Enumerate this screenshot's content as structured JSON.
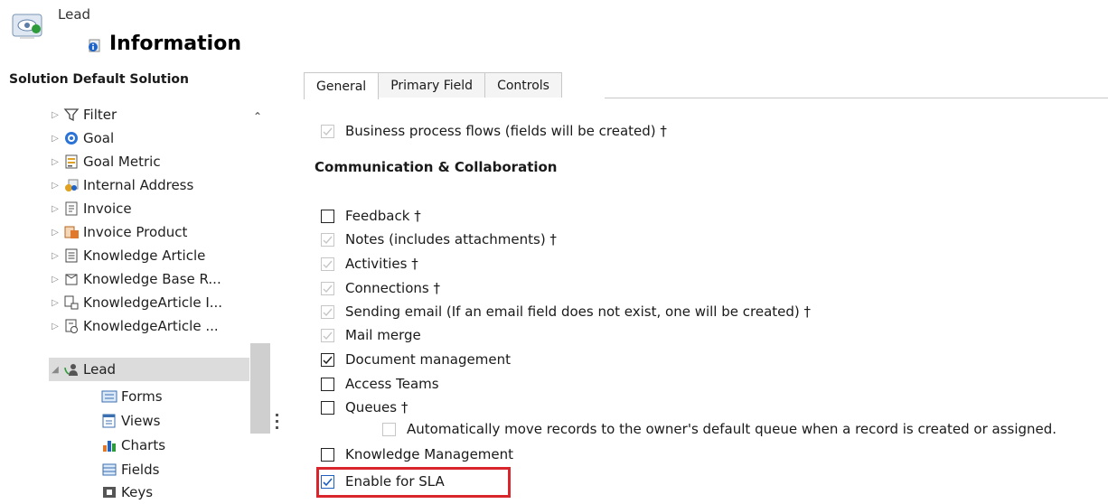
{
  "header": {
    "entity_name": "Lead",
    "page_title": "Information"
  },
  "solution": {
    "title": "Solution Default Solution"
  },
  "tree": {
    "items": [
      {
        "label": "Filter",
        "icon": "filter-icon"
      },
      {
        "label": "Goal",
        "icon": "goal-icon"
      },
      {
        "label": "Goal Metric",
        "icon": "goal-metric-icon"
      },
      {
        "label": "Internal Address",
        "icon": "address-icon"
      },
      {
        "label": "Invoice",
        "icon": "invoice-icon"
      },
      {
        "label": "Invoice Product",
        "icon": "invoice-product-icon"
      },
      {
        "label": "Knowledge Article",
        "icon": "article-icon"
      },
      {
        "label": "Knowledge Base R...",
        "icon": "kb-record-icon"
      },
      {
        "label": "KnowledgeArticle I...",
        "icon": "article-incident-icon"
      },
      {
        "label": "KnowledgeArticle ...",
        "icon": "article-views-icon"
      },
      {
        "label": "Lead",
        "icon": "lead-icon"
      }
    ],
    "children": [
      {
        "label": "Forms",
        "icon": "forms-icon"
      },
      {
        "label": "Views",
        "icon": "views-icon"
      },
      {
        "label": "Charts",
        "icon": "charts-icon"
      },
      {
        "label": "Fields",
        "icon": "fields-icon"
      },
      {
        "label": "Keys",
        "icon": "keys-icon"
      }
    ]
  },
  "tabs": [
    {
      "label": "General"
    },
    {
      "label": "Primary Field"
    },
    {
      "label": "Controls"
    }
  ],
  "options": {
    "bpf": "Business process flows (fields will be created) †",
    "section": "Communication & Collaboration",
    "feedback": "Feedback †",
    "notes": "Notes (includes attachments) †",
    "activities": "Activities †",
    "connections": "Connections †",
    "sending_email": "Sending email (If an email field does not exist, one will be created) †",
    "mail_merge": "Mail merge",
    "document_management": "Document management",
    "access_teams": "Access Teams",
    "queues": "Queues †",
    "auto_move": "Automatically move records to the owner's default queue when a record is created or assigned.",
    "knowledge_management": "Knowledge Management",
    "enable_sla": "Enable for SLA"
  },
  "colors": {
    "highlight": "#d9262c",
    "checkbox_blue": "#1f5fbf",
    "disabled": "#c6c6c6"
  }
}
